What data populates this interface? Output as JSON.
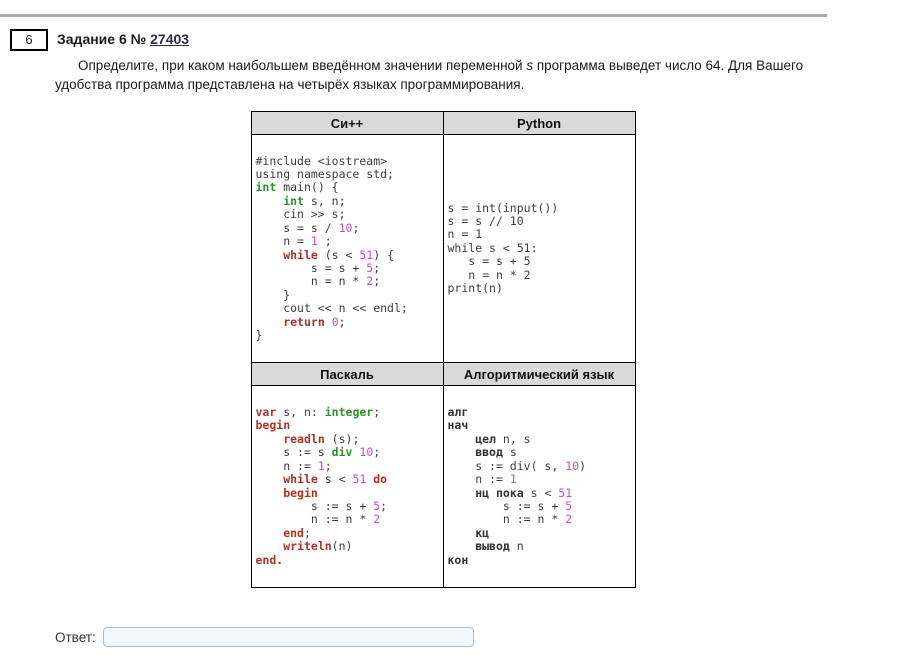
{
  "colors": {
    "top_rule": "#a8a8a8",
    "table_header_bg": "#d9d9d9",
    "table_border": "#000000",
    "code_plain": "#3c3c3c",
    "code_keyword_red": "#a93226",
    "code_type_green": "#309030",
    "code_number_magenta": "#c44fc4",
    "task_link": "#2b2b4e",
    "answer_input_border": "#a9c0d2",
    "answer_input_bg": "#f2f7fb"
  },
  "header": {
    "task_index": "6",
    "task_label": "Задание 6 № ",
    "task_link": "27403"
  },
  "problem": {
    "text_before_var": "Определите, при каком наибольшем введённом значении переменной ",
    "var": "s",
    "text_after_var": " программа выведет число 64. Для Вашего удобства программа представлена на четырёх языках программирования."
  },
  "table": {
    "headers": {
      "cpp": "Си++",
      "python": "Python",
      "pascal": "Паскаль",
      "algo": "Алгоритмический язык"
    },
    "code": {
      "cpp": [
        [
          [
            "p",
            "#include <iostream>"
          ]
        ],
        [
          [
            "p",
            "using namespace std;"
          ]
        ],
        [
          [
            "t",
            "int"
          ],
          [
            "p",
            " main() {"
          ]
        ],
        [
          [
            "p",
            "    "
          ],
          [
            "t",
            "int"
          ],
          [
            "p",
            " s, n;"
          ]
        ],
        [
          [
            "p",
            "    cin >> s;"
          ]
        ],
        [
          [
            "p",
            "    s = s / "
          ],
          [
            "n",
            "10"
          ],
          [
            "p",
            ";"
          ]
        ],
        [
          [
            "p",
            "    n = "
          ],
          [
            "n",
            "1"
          ],
          [
            "p",
            " ;"
          ]
        ],
        [
          [
            "p",
            "    "
          ],
          [
            "k",
            "while"
          ],
          [
            "p",
            " (s < "
          ],
          [
            "n",
            "51"
          ],
          [
            "p",
            ") {"
          ]
        ],
        [
          [
            "p",
            "        s = s + "
          ],
          [
            "n",
            "5"
          ],
          [
            "p",
            ";"
          ]
        ],
        [
          [
            "p",
            "        n = n * "
          ],
          [
            "n",
            "2"
          ],
          [
            "p",
            ";"
          ]
        ],
        [
          [
            "p",
            "    }"
          ]
        ],
        [
          [
            "p",
            "    cout << n << endl;"
          ]
        ],
        [
          [
            "p",
            "    "
          ],
          [
            "k",
            "return"
          ],
          [
            "p",
            " "
          ],
          [
            "n",
            "0"
          ],
          [
            "p",
            ";"
          ]
        ],
        [
          [
            "p",
            "}"
          ]
        ]
      ],
      "python": [
        [
          [
            "p",
            "s = int(input())"
          ]
        ],
        [
          [
            "p",
            "s = s // 10"
          ]
        ],
        [
          [
            "p",
            "n = 1"
          ]
        ],
        [
          [
            "p",
            "while s < 51:"
          ]
        ],
        [
          [
            "p",
            "   s = s + 5"
          ]
        ],
        [
          [
            "p",
            "   n = n * 2"
          ]
        ],
        [
          [
            "p",
            "print(n)"
          ]
        ]
      ],
      "pascal": [
        [
          [
            "k",
            "var"
          ],
          [
            "p",
            " s, n: "
          ],
          [
            "t",
            "integer"
          ],
          [
            "p",
            ";"
          ]
        ],
        [
          [
            "k",
            "begin"
          ]
        ],
        [
          [
            "p",
            "    "
          ],
          [
            "k",
            "readln"
          ],
          [
            "p",
            " (s);"
          ]
        ],
        [
          [
            "p",
            "    s := s "
          ],
          [
            "t",
            "div"
          ],
          [
            "p",
            " "
          ],
          [
            "n",
            "10"
          ],
          [
            "p",
            ";"
          ]
        ],
        [
          [
            "p",
            "    n := "
          ],
          [
            "n",
            "1"
          ],
          [
            "p",
            ";"
          ]
        ],
        [
          [
            "p",
            "    "
          ],
          [
            "k",
            "while"
          ],
          [
            "p",
            " s < "
          ],
          [
            "n",
            "51"
          ],
          [
            "p",
            " "
          ],
          [
            "k",
            "do"
          ]
        ],
        [
          [
            "p",
            "    "
          ],
          [
            "k",
            "begin"
          ]
        ],
        [
          [
            "p",
            "        s := s + "
          ],
          [
            "n",
            "5"
          ],
          [
            "p",
            ";"
          ]
        ],
        [
          [
            "p",
            "        n := n * "
          ],
          [
            "n",
            "2"
          ]
        ],
        [
          [
            "p",
            "    "
          ],
          [
            "k",
            "end"
          ],
          [
            "p",
            ";"
          ]
        ],
        [
          [
            "p",
            "    "
          ],
          [
            "k",
            "writeln"
          ],
          [
            "p",
            "(n)"
          ]
        ],
        [
          [
            "k",
            "end."
          ]
        ]
      ],
      "algo": [
        [
          [
            "b",
            "алг"
          ]
        ],
        [
          [
            "b",
            "нач"
          ]
        ],
        [
          [
            "p",
            "    "
          ],
          [
            "b",
            "цел"
          ],
          [
            "p",
            " n, s"
          ]
        ],
        [
          [
            "p",
            "    "
          ],
          [
            "b",
            "ввод"
          ],
          [
            "p",
            " s"
          ]
        ],
        [
          [
            "p",
            "    s := div( s, "
          ],
          [
            "n",
            "10"
          ],
          [
            "p",
            ")"
          ]
        ],
        [
          [
            "p",
            "    n := "
          ],
          [
            "n",
            "1"
          ]
        ],
        [
          [
            "p",
            "    "
          ],
          [
            "b",
            "нц пока"
          ],
          [
            "p",
            " s < "
          ],
          [
            "n",
            "51"
          ]
        ],
        [
          [
            "p",
            "        s := s + "
          ],
          [
            "n",
            "5"
          ]
        ],
        [
          [
            "p",
            "        n := n * "
          ],
          [
            "n",
            "2"
          ]
        ],
        [
          [
            "p",
            "    "
          ],
          [
            "b",
            "кц"
          ]
        ],
        [
          [
            "p",
            "    "
          ],
          [
            "b",
            "вывод"
          ],
          [
            "p",
            " n"
          ]
        ],
        [
          [
            "b",
            "кон"
          ]
        ]
      ]
    }
  },
  "answer": {
    "label": "Ответ:",
    "value": ""
  }
}
